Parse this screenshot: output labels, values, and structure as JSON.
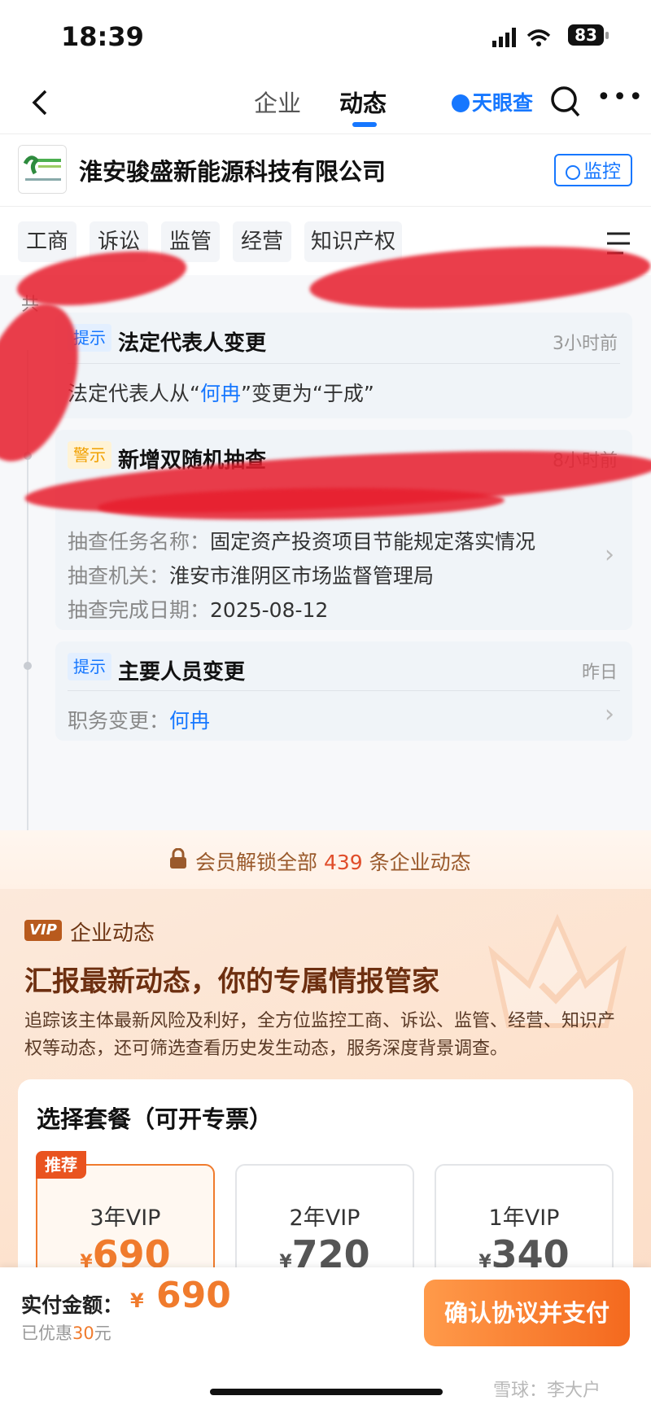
{
  "status_bar": {
    "time": "18:39",
    "battery": "83"
  },
  "nav": {
    "tabs": [
      "企业",
      "动态"
    ],
    "active_tab": "动态",
    "brand": "天眼查"
  },
  "company": {
    "name": "淮安骏盛新能源科技有限公司",
    "monitor_label": "监控"
  },
  "chips": [
    "工商",
    "诉讼",
    "监管",
    "经营",
    "知识产权"
  ],
  "summary_prefix": "共",
  "feed": [
    {
      "badge": "提示",
      "title": "法定代表人变更",
      "time": "3小时前",
      "line_pre": "法定代表人从“",
      "line_from": "何冉",
      "line_mid": "”变更为“于成”"
    },
    {
      "badge": "警示",
      "title": "新增双随机抽查",
      "time": "8小时前",
      "rows": [
        {
          "label": "抽查任务名称：",
          "value": "固定资产投资项目节能规定落实情况"
        },
        {
          "label": "抽查机关：",
          "value": "淮安市淮阴区市场监督管理局"
        },
        {
          "label": "抽查完成日期：",
          "value": "2025-08-12"
        }
      ]
    },
    {
      "badge": "提示",
      "title": "主要人员变更",
      "time": "昨日",
      "label": "职务变更：",
      "value": "何冉"
    }
  ],
  "unlock": {
    "pre": "会员解锁全部",
    "count": "439",
    "post": "条企业动态"
  },
  "vip": {
    "tag": "VIP",
    "name": "企业动态",
    "heading": "汇报最新动态，你的专属情报管家",
    "desc": "追踪该主体最新风险及利好，全方位监控工商、诉讼、监管、经营、知识产权等动态，还可筛选查看历史发生动态，服务深度背景调查。",
    "package_title": "选择套餐（可开专票）",
    "recommend": "推荐",
    "plans": [
      {
        "name": "3年VIP",
        "currency": "¥",
        "price": "690",
        "selected": true
      },
      {
        "name": "2年VIP",
        "currency": "¥",
        "price": "720",
        "selected": false
      },
      {
        "name": "1年VIP",
        "currency": "¥",
        "price": "340",
        "selected": false
      }
    ]
  },
  "bottom": {
    "pay_label": "实付金额：",
    "currency": "¥",
    "amount": "690",
    "saved_pre": "已优惠",
    "saved_amount": "30",
    "saved_post": "元",
    "pay_button": "确认协议并支付"
  },
  "watermark": "雪球：李大户",
  "colors": {
    "accent": "#1677ff",
    "orange": "#f07b2d",
    "warn": "#f1a000",
    "scribble": "#e61e2d"
  }
}
